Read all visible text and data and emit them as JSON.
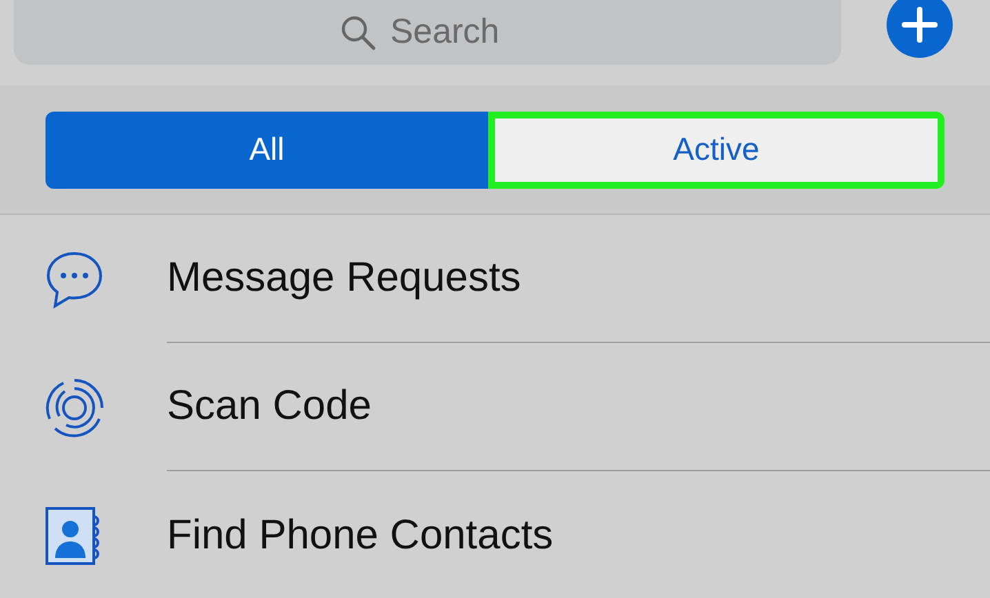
{
  "search": {
    "placeholder": "Search"
  },
  "tabs": [
    {
      "label": "All",
      "selected": true,
      "highlighted": false
    },
    {
      "label": "Active",
      "selected": false,
      "highlighted": true
    }
  ],
  "items": [
    {
      "kind": "requests",
      "label": "Message Requests"
    },
    {
      "kind": "scan",
      "label": "Scan Code"
    },
    {
      "kind": "contacts",
      "label": "Find Phone Contacts"
    }
  ]
}
